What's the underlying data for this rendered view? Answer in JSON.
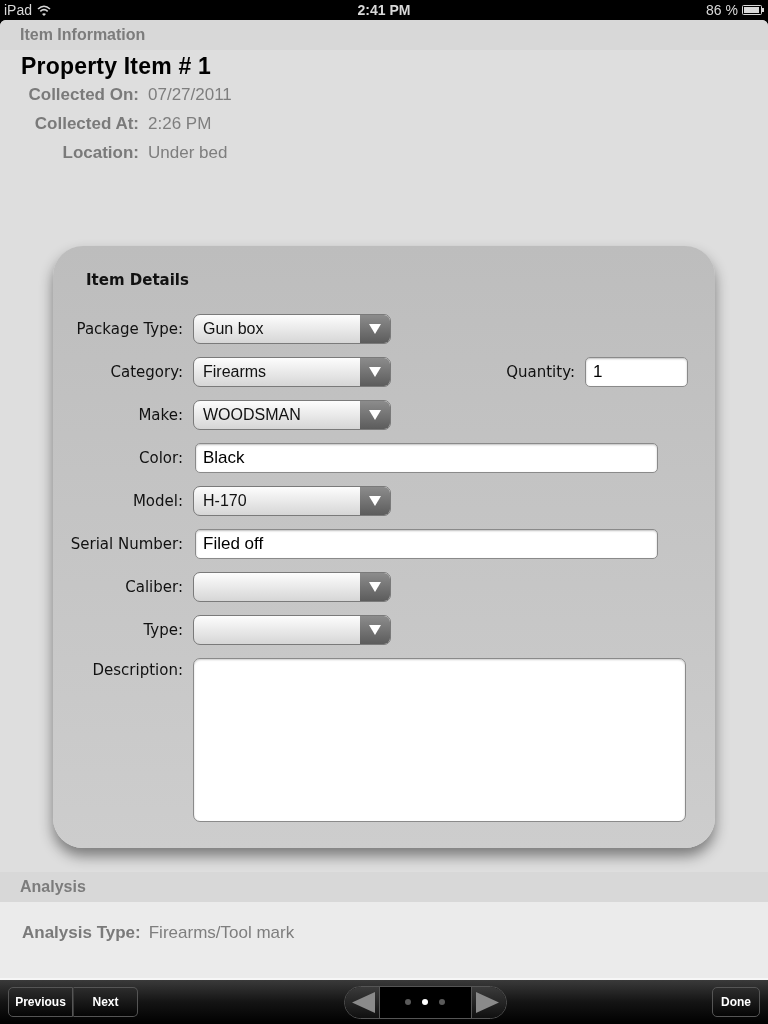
{
  "status_bar": {
    "carrier": "iPad",
    "time": "2:41 PM",
    "battery": "86 %"
  },
  "item_information": {
    "header": "Item Information",
    "title": "Property Item # 1",
    "fields": [
      {
        "label": "Collected On:",
        "value": "07/27/2011"
      },
      {
        "label": "Collected At:",
        "value": "2:26 PM"
      },
      {
        "label": "Location:",
        "value": "Under bed"
      }
    ]
  },
  "item_details": {
    "title": "Item Details",
    "rows": [
      {
        "fields": [
          {
            "kind": "select",
            "label": "Package Type:",
            "value": "Gun box"
          }
        ]
      },
      {
        "fields": [
          {
            "kind": "select",
            "label": "Category:",
            "value": "Firearms"
          },
          {
            "kind": "text",
            "label": "Quantity:",
            "value": "1"
          }
        ]
      },
      {
        "fields": [
          {
            "kind": "select",
            "label": "Make:",
            "value": "WOODSMAN"
          }
        ]
      },
      {
        "fields": [
          {
            "kind": "text",
            "label": "Color:",
            "value": "Black"
          }
        ]
      },
      {
        "fields": [
          {
            "kind": "select",
            "label": "Model:",
            "value": "H-170"
          }
        ]
      },
      {
        "fields": [
          {
            "kind": "text",
            "label": "Serial Number:",
            "value": "Filed off"
          }
        ]
      },
      {
        "fields": [
          {
            "kind": "select",
            "label": "Caliber:"
          }
        ]
      },
      {
        "fields": [
          {
            "kind": "select",
            "label": "Type:"
          }
        ]
      },
      {
        "fields": [
          {
            "kind": "textarea",
            "label": "Description:"
          }
        ]
      }
    ]
  },
  "analysis": {
    "header": "Analysis",
    "fields": [
      {
        "label": "Analysis Type:",
        "value": "Firearms/Tool mark"
      }
    ]
  },
  "toolbar": {
    "nav_buttons": [
      "Previous",
      "Next"
    ],
    "pages": [
      {
        "selected": false
      },
      {
        "selected": true
      },
      {
        "selected": false
      }
    ],
    "done_button": "Done"
  }
}
